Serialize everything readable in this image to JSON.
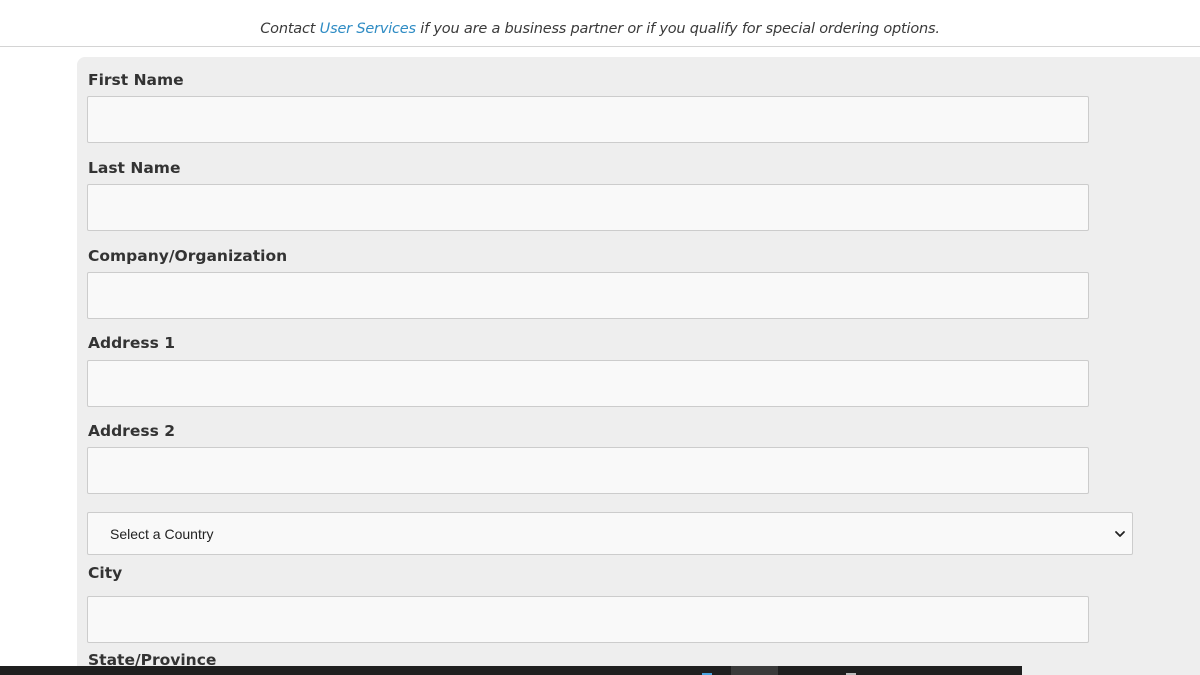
{
  "notice": {
    "prefix": "Contact ",
    "link_text": "User Services",
    "suffix": " if you are a business partner or if you qualify for special ordering options."
  },
  "form": {
    "first_name": {
      "label": "First Name",
      "value": ""
    },
    "last_name": {
      "label": "Last Name",
      "value": ""
    },
    "company": {
      "label": "Company/Organization",
      "value": ""
    },
    "address1": {
      "label": "Address 1",
      "value": ""
    },
    "address2": {
      "label": "Address 2",
      "value": ""
    },
    "country": {
      "selected": "Select a Country"
    },
    "city": {
      "label": "City",
      "value": ""
    },
    "state": {
      "label": "State/Province"
    }
  },
  "icons": {
    "select_chevron": "chevron-down-icon"
  },
  "colors": {
    "link": "#2f8cc4",
    "panel_bg": "#eeeeee",
    "input_bg": "#f9f9f9",
    "input_border": "#cccccc",
    "taskbar": "#1f1f1f"
  }
}
